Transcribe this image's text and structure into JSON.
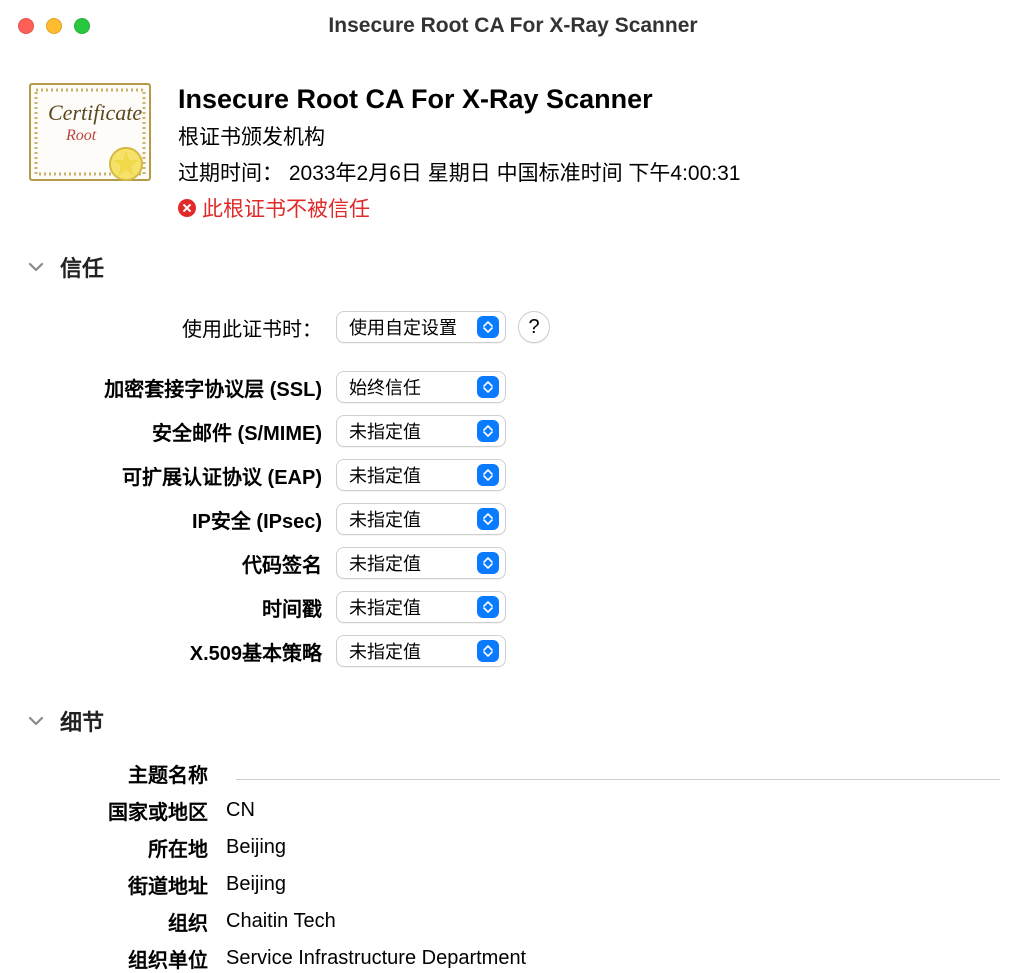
{
  "window": {
    "title": "Insecure Root CA For X-Ray Scanner"
  },
  "certificate": {
    "name": "Insecure Root CA For X-Ray Scanner",
    "authority_type": "根证书颁发机构",
    "expiry_label": "过期时间：",
    "expiry_value": "2033年2月6日 星期日 中国标准时间 下午4:00:31",
    "status_text": "此根证书不被信任",
    "icon_word_top": "Certificate",
    "icon_word_sub": "Root"
  },
  "sections": {
    "trust_title": "信任",
    "details_title": "细节"
  },
  "trust": {
    "use_cert_label": "使用此证书时：",
    "use_cert_value": "使用自定设置",
    "help_glyph": "?",
    "rows": [
      {
        "label": "加密套接字协议层 (SSL)",
        "value": "始终信任"
      },
      {
        "label": "安全邮件 (S/MIME)",
        "value": "未指定值"
      },
      {
        "label": "可扩展认证协议 (EAP)",
        "value": "未指定值"
      },
      {
        "label": "IP安全 (IPsec)",
        "value": "未指定值"
      },
      {
        "label": "代码签名",
        "value": "未指定值"
      },
      {
        "label": "时间戳",
        "value": "未指定值"
      },
      {
        "label": "X.509基本策略",
        "value": "未指定值"
      }
    ]
  },
  "details": {
    "subject_heading": "主题名称",
    "rows": [
      {
        "label": "国家或地区",
        "value": "CN"
      },
      {
        "label": "所在地",
        "value": "Beijing"
      },
      {
        "label": "街道地址",
        "value": "Beijing"
      },
      {
        "label": "组织",
        "value": "Chaitin Tech"
      },
      {
        "label": "组织单位",
        "value": "Service Infrastructure Department"
      }
    ]
  }
}
